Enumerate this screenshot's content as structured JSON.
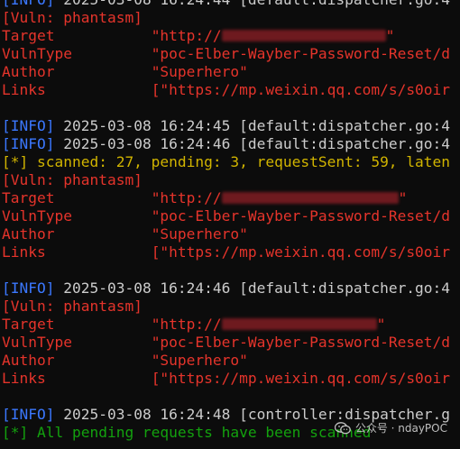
{
  "terminal": {
    "lines": [
      {
        "type": "info",
        "tag": "[INFO]",
        "text": " 2025-03-08 16:24:44 [default:dispatcher.go:4"
      },
      {
        "type": "vuln",
        "text": "[Vuln: phantasm]"
      },
      {
        "type": "kv",
        "key": "Target",
        "value_prefix": "\"http://",
        "value_suffix": "\"",
        "redacted": true
      },
      {
        "type": "kv",
        "key": "VulnType",
        "value": "\"poc-Elber-Wayber-Password-Reset/d"
      },
      {
        "type": "kv",
        "key": "Author",
        "value": "\"Superhero\""
      },
      {
        "type": "kv",
        "key": "Links",
        "value": "[\"https://mp.weixin.qq.com/s/s0oir"
      },
      {
        "type": "blank"
      },
      {
        "type": "info",
        "tag": "[INFO]",
        "text": " 2025-03-08 16:24:45 [default:dispatcher.go:4"
      },
      {
        "type": "info",
        "tag": "[INFO]",
        "text": " 2025-03-08 16:24:46 [default:dispatcher.go:4"
      },
      {
        "type": "status",
        "text": "[*] scanned: 27, pending: 3, requestSent: 59, laten"
      },
      {
        "type": "vuln",
        "text": "[Vuln: phantasm]"
      },
      {
        "type": "kv",
        "key": "Target",
        "value_prefix": "\"http://",
        "value_suffix": "\"",
        "redacted": true
      },
      {
        "type": "kv",
        "key": "VulnType",
        "value": "\"poc-Elber-Wayber-Password-Reset/d"
      },
      {
        "type": "kv",
        "key": "Author",
        "value": "\"Superhero\""
      },
      {
        "type": "kv",
        "key": "Links",
        "value": "[\"https://mp.weixin.qq.com/s/s0oir"
      },
      {
        "type": "blank"
      },
      {
        "type": "info",
        "tag": "[INFO]",
        "text": " 2025-03-08 16:24:46 [default:dispatcher.go:4"
      },
      {
        "type": "vuln",
        "text": "[Vuln: phantasm]"
      },
      {
        "type": "kv",
        "key": "Target",
        "value_prefix": "\"http://",
        "value_suffix": "\"",
        "redacted": true
      },
      {
        "type": "kv",
        "key": "VulnType",
        "value": "\"poc-Elber-Wayber-Password-Reset/d"
      },
      {
        "type": "kv",
        "key": "Author",
        "value": "\"Superhero\""
      },
      {
        "type": "kv",
        "key": "Links",
        "value": "[\"https://mp.weixin.qq.com/s/s0oir"
      },
      {
        "type": "blank"
      },
      {
        "type": "info",
        "tag": "[INFO]",
        "text": " 2025-03-08 16:24:48 [controller:dispatcher.g"
      },
      {
        "type": "done",
        "text": "[*] All pending requests have been scanned"
      }
    ]
  },
  "watermark": {
    "text": "公众号 · ndayPOC",
    "icon": "wechat-icon"
  },
  "colors": {
    "background": "#0c0c0c",
    "info": "#3b78ff",
    "red": "#e5342b",
    "yellow": "#d1b400",
    "green": "#13a10e",
    "text": "#cccccc"
  }
}
